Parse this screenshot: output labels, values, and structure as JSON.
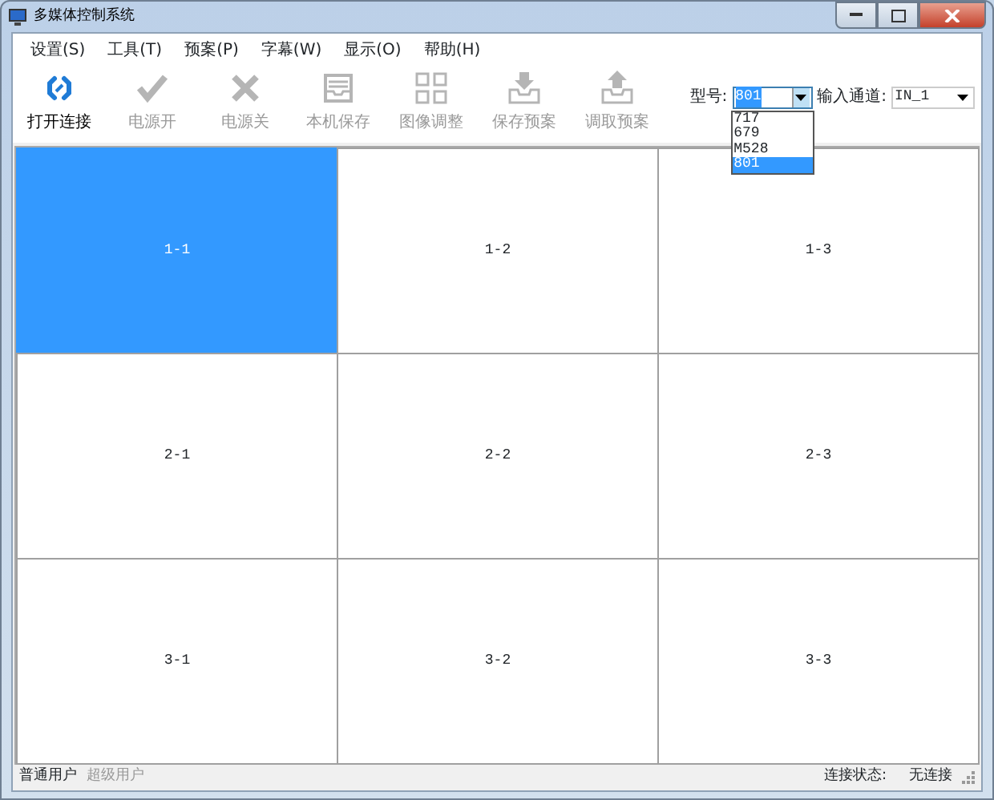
{
  "window": {
    "title": "多媒体控制系统"
  },
  "menu": [
    "设置(S)",
    "工具(T)",
    "预案(P)",
    "字幕(W)",
    "显示(O)",
    "帮助(H)"
  ],
  "toolbar": [
    {
      "kind": "link",
      "label": "打开连接",
      "disabled": false
    },
    {
      "kind": "check",
      "label": "电源开",
      "disabled": true
    },
    {
      "kind": "cross",
      "label": "电源关",
      "disabled": true
    },
    {
      "kind": "tray",
      "label": "本机保存",
      "disabled": true
    },
    {
      "kind": "grid",
      "label": "图像调整",
      "disabled": true
    },
    {
      "kind": "down",
      "label": "保存预案",
      "disabled": true
    },
    {
      "kind": "up",
      "label": "调取预案",
      "disabled": true
    }
  ],
  "model": {
    "label": "型号:",
    "value": "801",
    "expanded": true,
    "options": [
      {
        "label": "717",
        "selected": false
      },
      {
        "label": "679",
        "selected": false
      },
      {
        "label": "M528",
        "selected": false
      },
      {
        "label": "801",
        "selected": true
      }
    ]
  },
  "channel": {
    "label": "输入通道:",
    "value": "IN_1"
  },
  "grid": [
    [
      {
        "label": "1-1",
        "selected": true
      },
      {
        "label": "1-2",
        "selected": false
      },
      {
        "label": "1-3",
        "selected": false
      }
    ],
    [
      {
        "label": "2-1",
        "selected": false
      },
      {
        "label": "2-2",
        "selected": false
      },
      {
        "label": "2-3",
        "selected": false
      }
    ],
    [
      {
        "label": "3-1",
        "selected": false
      },
      {
        "label": "3-2",
        "selected": false
      },
      {
        "label": "3-3",
        "selected": false
      }
    ]
  ],
  "status_bar": {
    "users": [
      {
        "label": "普通用户",
        "disabled": false
      },
      {
        "label": "超级用户",
        "disabled": true
      }
    ],
    "connection_label": "连接状态:",
    "connection_value": "无连接"
  }
}
